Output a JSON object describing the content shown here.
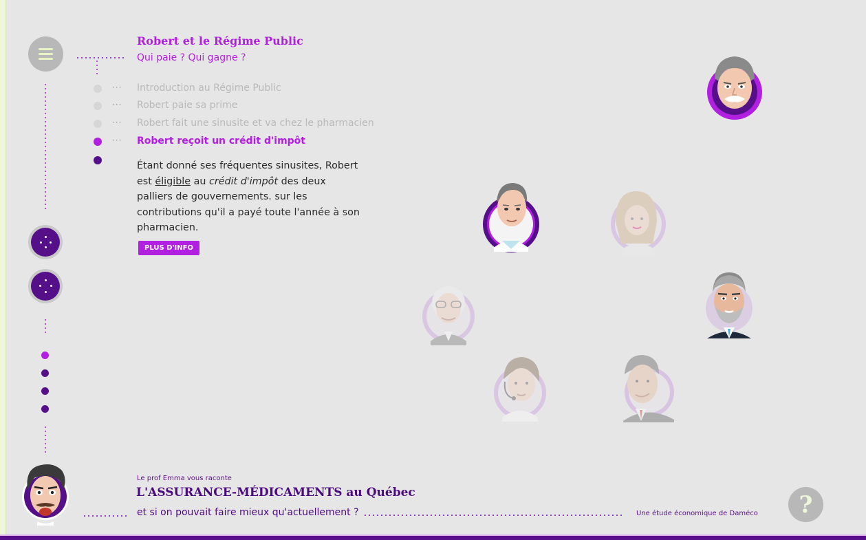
{
  "header": {
    "title": "Robert et le Régime Public",
    "subtitle": "Qui paie ? Qui gagne ?"
  },
  "steps": [
    {
      "label": "Introduction au Régime Public",
      "active": false
    },
    {
      "label": "Robert paie sa prime",
      "active": false
    },
    {
      "label": "Robert fait une sinusite et va chez le pharmacien",
      "active": false
    },
    {
      "label": "Robert reçoit un crédit d'impôt",
      "active": true
    }
  ],
  "body": {
    "p1": "Étant donné ses fréquentes sinusites, Robert est ",
    "eligible": "éligible",
    "p2": " au ",
    "credit": "crédit d'impôt",
    "p3": " des deux palliers de gouvernements. sur les contributions qu'il a payé toute l'année à son pharmacien."
  },
  "info_button": "PLUS D'INFO",
  "footer": {
    "narrator": "Le prof Emma vous raconte",
    "title": "L'ASSURANCE-MÉDICAMENTS au Québec",
    "subtitle": "et si on pouvait faire mieux qu'actuellement ?",
    "credit": "Une étude économique de Daméco"
  },
  "help_button": "?",
  "characters": [
    {
      "name": "old-man-avatar"
    },
    {
      "name": "robert-avatar"
    },
    {
      "name": "woman-avatar"
    },
    {
      "name": "elderly-glasses-avatar"
    },
    {
      "name": "grey-beard-man-avatar"
    },
    {
      "name": "call-center-avatar"
    },
    {
      "name": "suit-man-avatar"
    },
    {
      "name": "professor-avatar"
    }
  ],
  "colors": {
    "accent": "#b11fe0",
    "dark_purple": "#4b0a7e",
    "background": "#e6e6e6"
  }
}
